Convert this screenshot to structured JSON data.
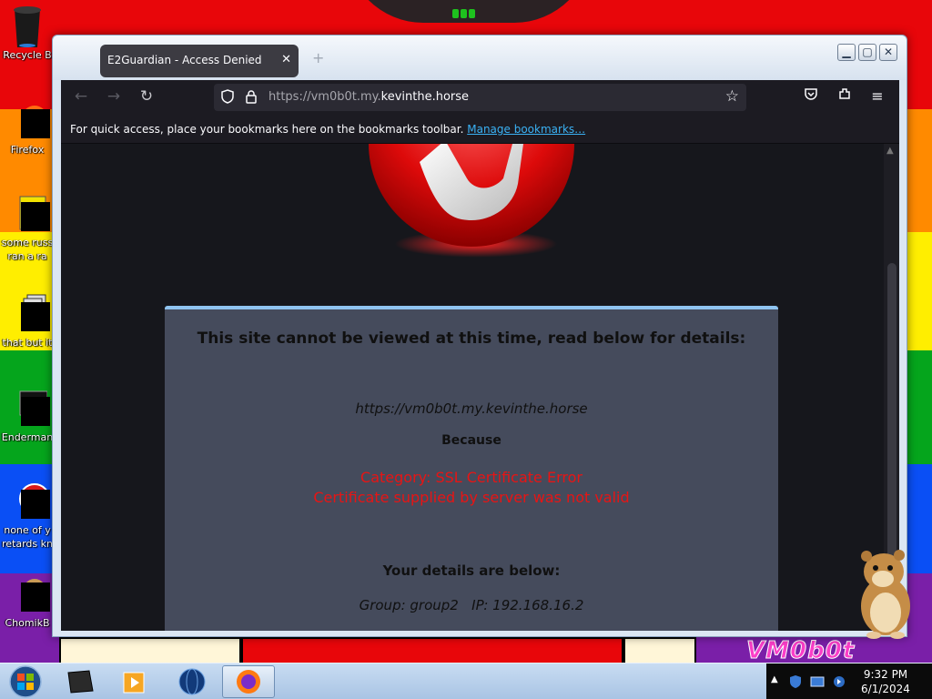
{
  "desktop": {
    "icons": [
      {
        "label": "Recycle B",
        "icon": "recycle-bin-icon"
      },
      {
        "label": "Firefox",
        "icon": "firefox-icon"
      },
      {
        "label": "some russ",
        "label2": "ran a ra",
        "icon": "document-icon"
      },
      {
        "label": "that but it",
        "icon": "window-icon"
      },
      {
        "label": "Enderman",
        "icon": "terminal-icon"
      },
      {
        "label": "none of y",
        "label2": "retards kn",
        "icon": "app-icon"
      },
      {
        "label": "ChomikB",
        "icon": "hamster-icon"
      }
    ],
    "wallpaper_text": "VM0b0t"
  },
  "window": {
    "tab_title": "E2Guardian - Access Denied",
    "new_tab_symbol": "+",
    "controls": {
      "minimize": "▁",
      "maximize": "▢",
      "close": "✕"
    }
  },
  "navbar": {
    "url_prefix": "https://vm0b0t.my.",
    "url_domain": "kevinthe.horse"
  },
  "bookmarks_bar": {
    "text": "For quick access, place your bookmarks here on the bookmarks toolbar.",
    "link": "Manage bookmarks…"
  },
  "page": {
    "heading": "This site cannot be viewed at this time, read below for details:",
    "url": "https://vm0b0t.my.kevinthe.horse",
    "because": "Because",
    "error_category": "Category: SSL Certificate Error",
    "error_detail": "Certificate supplied by server was not valid",
    "details_heading": "Your details are below:",
    "group_info": "Group: group2   IP: 192.168.16.2"
  },
  "taskbar": {
    "time": "9:32 PM",
    "date": "6/1/2024"
  },
  "colors": {
    "panel_bg": "#454b5c",
    "panel_border": "#8fc4f0",
    "error_red": "#e81414",
    "link_blue": "#3ab2f5"
  }
}
